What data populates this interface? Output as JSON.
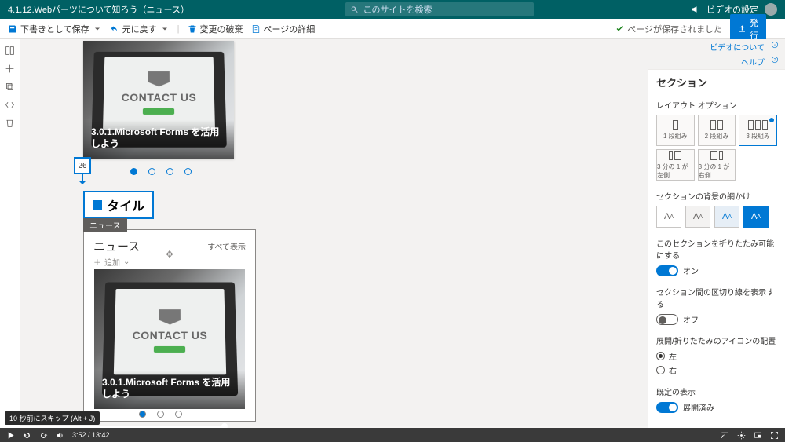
{
  "suitebar": {
    "title": "4.1.12.Webパーツについて知ろう（ニュース）",
    "search_placeholder": "このサイトを検索",
    "settings_label": "ビデオの設定"
  },
  "cmdbar": {
    "save": "下書きとして保存",
    "undo": "元に戻す",
    "discard": "変更の破棄",
    "details": "ページの詳細",
    "saved": "ページが保存されました",
    "publish": "発行"
  },
  "canvas": {
    "card1_title": "3.0.1.Microsoft Forms を活用しよう",
    "card_contact": "CONTACT US",
    "step_badge": "26",
    "callout": "タイル",
    "wp_tab": "ニュース",
    "wp_title": "ニュース",
    "wp_all": "すべて表示",
    "wp_add": "追加",
    "card2_title": "3.0.1.Microsoft Forms を活用しよう"
  },
  "panel": {
    "link_video": "ビデオについて",
    "link_help": "ヘルプ",
    "title": "セクション",
    "layout_label": "レイアウト オプション",
    "layouts": [
      "1 段組み",
      "2 段組み",
      "3 段組み",
      "3 分の 1 が左側",
      "3 分の 1 が右側"
    ],
    "bg_label": "セクションの背景の網かけ",
    "collapse_label": "このセクションを折りたたみ可能にする",
    "on": "オン",
    "divider_label": "セクション間の区切り線を表示する",
    "off": "オフ",
    "icon_label": "展開/折りたたみのアイコンの配置",
    "left": "左",
    "right": "右",
    "default_label": "既定の表示",
    "expanded": "展開済み"
  },
  "video": {
    "tooltip": "10 秒前にスキップ (Alt + J)",
    "time": "3:52 / 13:42"
  }
}
